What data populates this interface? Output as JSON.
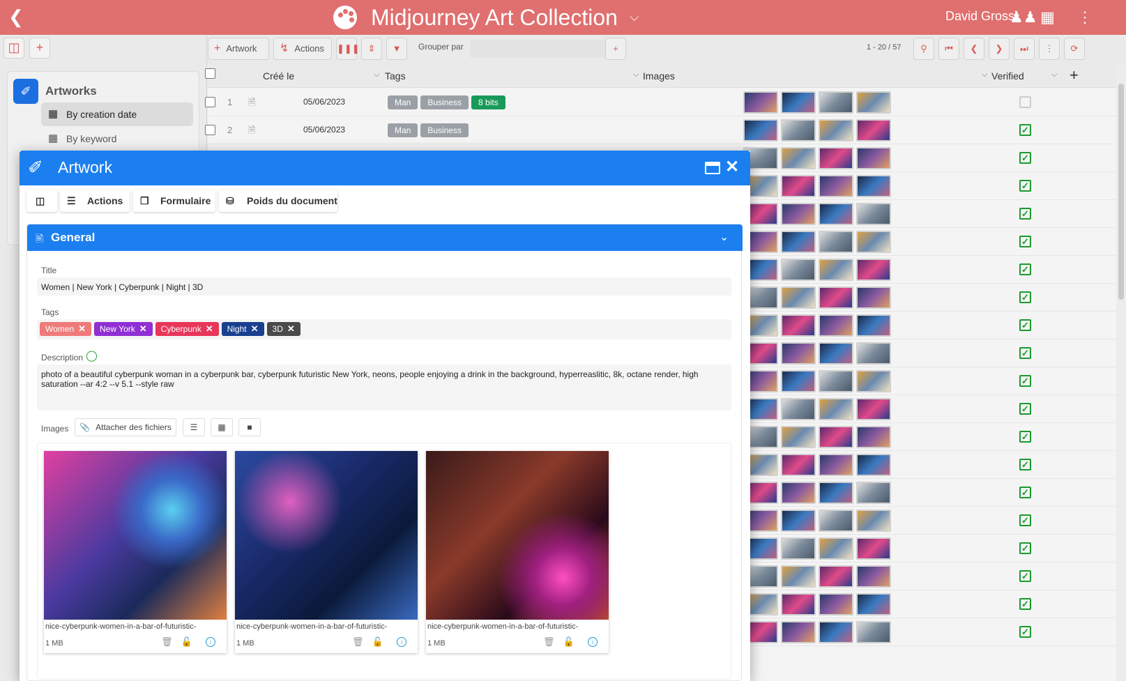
{
  "header": {
    "title": "Midjourney Art Collection",
    "user": "David Grossi",
    "back_icon": "chevron-left-icon"
  },
  "sidebar": {
    "app_title": "Artworks",
    "items": [
      {
        "label": "By creation date",
        "active": true
      },
      {
        "label": "By keyword",
        "active": false
      }
    ]
  },
  "toolbar": {
    "add_artwork_label": "Artwork",
    "actions_label": "Actions",
    "group_by_label": "Grouper par",
    "pager": "1 - 20 / 57"
  },
  "grid": {
    "columns": {
      "created": "Créé le",
      "tags": "Tags",
      "images": "Images",
      "verified": "Verified"
    },
    "rows": [
      {
        "num": "1",
        "date": "05/06/2023",
        "tags": [
          {
            "label": "Man",
            "color": "#9aa0a6"
          },
          {
            "label": "Business",
            "color": "#9aa0a6"
          },
          {
            "label": "8 bits",
            "color": "#1a9a5a"
          }
        ],
        "verified": false
      },
      {
        "num": "2",
        "date": "05/06/2023",
        "tags": [
          {
            "label": "Man",
            "color": "#9aa0a6"
          },
          {
            "label": "Business",
            "color": "#9aa0a6"
          }
        ],
        "verified": true
      }
    ]
  },
  "modal": {
    "title": "Artwork",
    "tabs": {
      "actions": "Actions",
      "form": "Formulaire",
      "weight": "Poids du document"
    },
    "section": "General",
    "fields": {
      "title_label": "Title",
      "title_value": "Women | New York | Cyberpunk | Night | 3D",
      "tags_label": "Tags",
      "tags": [
        {
          "label": "Women",
          "color": "#f07a7a"
        },
        {
          "label": "New York",
          "color": "#8f2fd4"
        },
        {
          "label": "Cyberpunk",
          "color": "#e8355a"
        },
        {
          "label": "Night",
          "color": "#1a3f8f"
        },
        {
          "label": "3D",
          "color": "#4a4a4a"
        }
      ],
      "description_label": "Description",
      "description_value": "photo of a beautiful cyberpunk woman in a cyberpunk bar, cyberpunk futuristic New York, neons, people enjoying a drink in the background, hyperreaslitic, 8k, octane render, high saturation --ar 4:2 --v 5.1 --style raw",
      "images_label": "Images",
      "attach_label": "Attacher des fichiers"
    },
    "images": [
      {
        "name": "nice-cyberpunk-women-in-a-bar-of-futuristic-",
        "size": "1 MB"
      },
      {
        "name": "nice-cyberpunk-women-in-a-bar-of-futuristic-",
        "size": "1 MB"
      },
      {
        "name": "nice-cyberpunk-women-in-a-bar-of-futuristic-",
        "size": "1 MB"
      }
    ]
  },
  "colors": {
    "header": "#e06f6f",
    "accent": "#1b7ff0",
    "verified": "#1a9a2e"
  }
}
